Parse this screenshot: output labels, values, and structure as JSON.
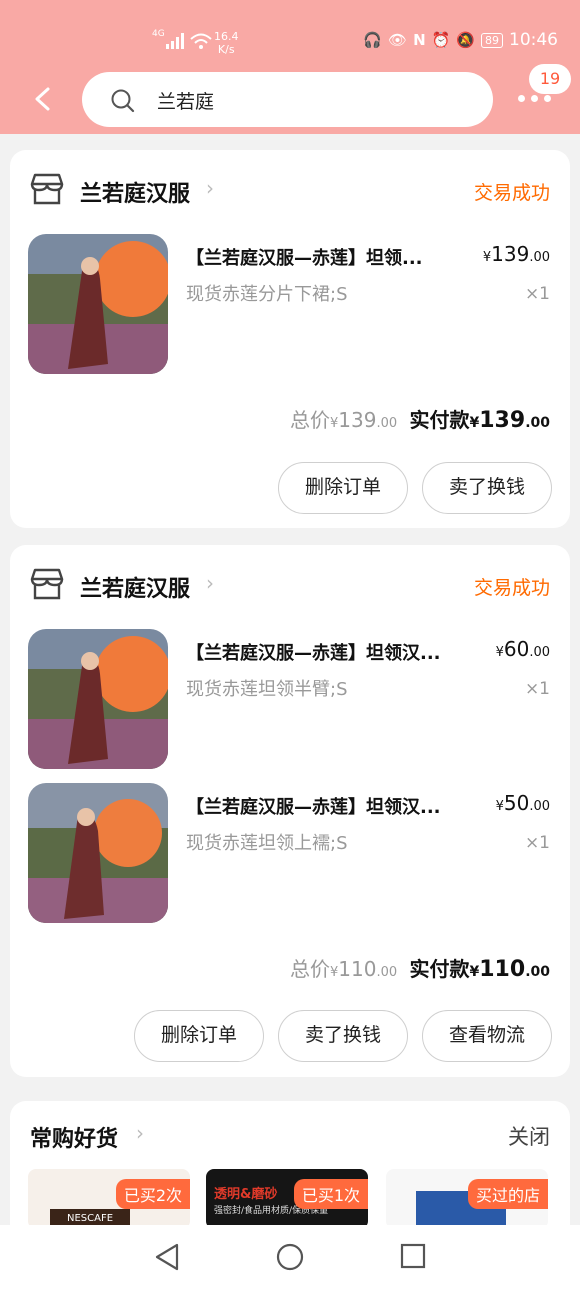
{
  "status_bar": {
    "signal": "4G",
    "net_speed": "16.4",
    "net_unit": "K/s",
    "battery": "89",
    "time": "10:46"
  },
  "header": {
    "search_text": "兰若庭",
    "badge_count": "19"
  },
  "orders": [
    {
      "shop_name": "兰若庭汉服",
      "status": "交易成功",
      "items": [
        {
          "title": "【兰若庭汉服—赤莲】坦领...",
          "sku": "现货赤莲分片下裙;S",
          "price_int": "139",
          "price_dec": ".00",
          "qty": "×1"
        }
      ],
      "total_label": "总价",
      "total_int": "139",
      "total_dec": ".00",
      "paid_label": "实付款",
      "paid_int": "139",
      "paid_dec": ".00",
      "buttons": [
        "删除订单",
        "卖了换钱"
      ]
    },
    {
      "shop_name": "兰若庭汉服",
      "status": "交易成功",
      "items": [
        {
          "title": "【兰若庭汉服—赤莲】坦领汉...",
          "sku": "现货赤莲坦领半臂;S",
          "price_int": "60",
          "price_dec": ".00",
          "qty": "×1"
        },
        {
          "title": "【兰若庭汉服—赤莲】坦领汉...",
          "sku": "现货赤莲坦领上襦;S",
          "price_int": "50",
          "price_dec": ".00",
          "qty": "×1"
        }
      ],
      "total_label": "总价",
      "total_int": "110",
      "total_dec": ".00",
      "paid_label": "实付款",
      "paid_int": "110",
      "paid_dec": ".00",
      "buttons": [
        "删除订单",
        "卖了换钱",
        "查看物流"
      ]
    }
  ],
  "currency": "¥",
  "frequent_goods": {
    "title": "常购好货",
    "close_label": "关闭",
    "items": [
      {
        "tag": "已买2次",
        "brand": "NESCAFE"
      },
      {
        "tag": "已买1次",
        "brand": "透明&磨砂",
        "sub": "强密封/食品用材质/保质保量"
      },
      {
        "tag": "买过的店"
      }
    ]
  },
  "colors": {
    "header_bg": "#f9a9a5",
    "status_orange": "#ff6a00",
    "tag_orange": "#ff6a3d"
  }
}
